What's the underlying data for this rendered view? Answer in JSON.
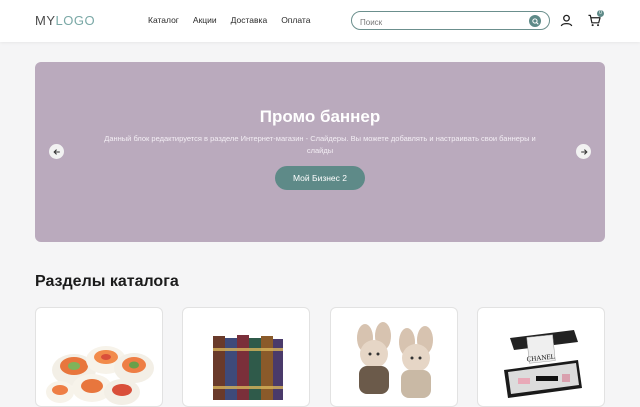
{
  "header": {
    "logo_part1": "MY",
    "logo_part2": "LOGO",
    "nav": [
      "Каталог",
      "Акции",
      "Доставка",
      "Оплата"
    ],
    "search_placeholder": "Поиск",
    "cart_count": "0"
  },
  "banner": {
    "title": "Промо баннер",
    "text": "Данный блок редактируется в разделе Интернет-магазин - Слайдеры. Вы можете добавлять и настраивать свои баннеры и слайды",
    "button": "Мой Бизнес 2"
  },
  "catalog": {
    "title": "Разделы каталога",
    "cards": [
      {
        "icon": "sushi-image"
      },
      {
        "icon": "books-image"
      },
      {
        "icon": "toys-image"
      },
      {
        "icon": "perfume-image",
        "brand_text": "CHANEL"
      }
    ]
  },
  "colors": {
    "accent": "#5e8a88",
    "banner_bg": "#baaabd",
    "logo_accent": "#7aa8a6"
  }
}
